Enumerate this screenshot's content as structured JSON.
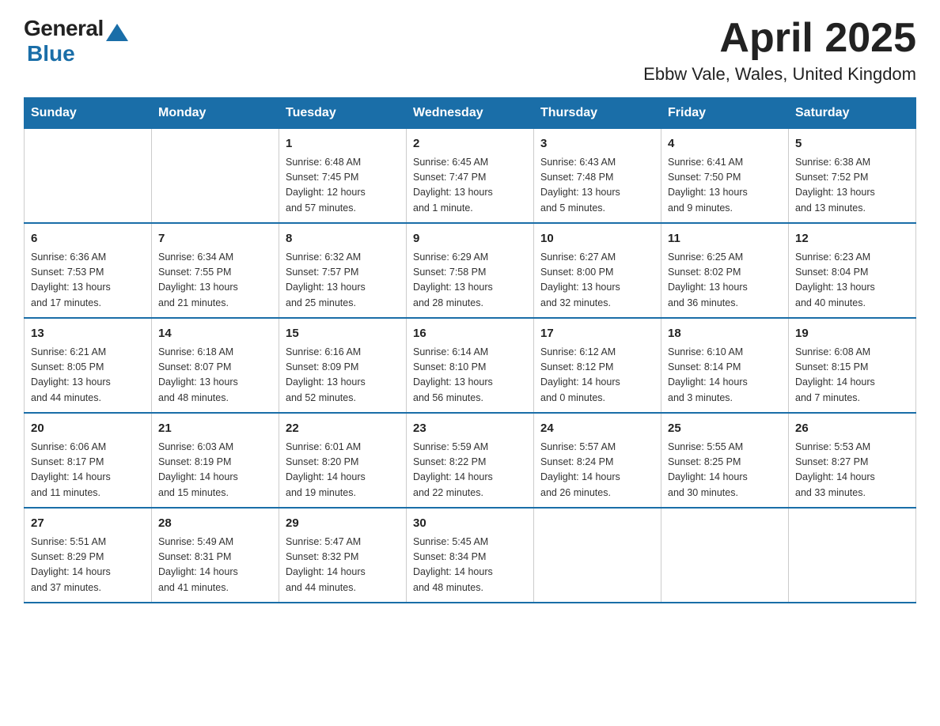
{
  "header": {
    "logo_general": "General",
    "logo_blue": "Blue",
    "title": "April 2025",
    "subtitle": "Ebbw Vale, Wales, United Kingdom"
  },
  "days_of_week": [
    "Sunday",
    "Monday",
    "Tuesday",
    "Wednesday",
    "Thursday",
    "Friday",
    "Saturday"
  ],
  "weeks": [
    [
      {
        "day": "",
        "info": ""
      },
      {
        "day": "",
        "info": ""
      },
      {
        "day": "1",
        "info": "Sunrise: 6:48 AM\nSunset: 7:45 PM\nDaylight: 12 hours\nand 57 minutes."
      },
      {
        "day": "2",
        "info": "Sunrise: 6:45 AM\nSunset: 7:47 PM\nDaylight: 13 hours\nand 1 minute."
      },
      {
        "day": "3",
        "info": "Sunrise: 6:43 AM\nSunset: 7:48 PM\nDaylight: 13 hours\nand 5 minutes."
      },
      {
        "day": "4",
        "info": "Sunrise: 6:41 AM\nSunset: 7:50 PM\nDaylight: 13 hours\nand 9 minutes."
      },
      {
        "day": "5",
        "info": "Sunrise: 6:38 AM\nSunset: 7:52 PM\nDaylight: 13 hours\nand 13 minutes."
      }
    ],
    [
      {
        "day": "6",
        "info": "Sunrise: 6:36 AM\nSunset: 7:53 PM\nDaylight: 13 hours\nand 17 minutes."
      },
      {
        "day": "7",
        "info": "Sunrise: 6:34 AM\nSunset: 7:55 PM\nDaylight: 13 hours\nand 21 minutes."
      },
      {
        "day": "8",
        "info": "Sunrise: 6:32 AM\nSunset: 7:57 PM\nDaylight: 13 hours\nand 25 minutes."
      },
      {
        "day": "9",
        "info": "Sunrise: 6:29 AM\nSunset: 7:58 PM\nDaylight: 13 hours\nand 28 minutes."
      },
      {
        "day": "10",
        "info": "Sunrise: 6:27 AM\nSunset: 8:00 PM\nDaylight: 13 hours\nand 32 minutes."
      },
      {
        "day": "11",
        "info": "Sunrise: 6:25 AM\nSunset: 8:02 PM\nDaylight: 13 hours\nand 36 minutes."
      },
      {
        "day": "12",
        "info": "Sunrise: 6:23 AM\nSunset: 8:04 PM\nDaylight: 13 hours\nand 40 minutes."
      }
    ],
    [
      {
        "day": "13",
        "info": "Sunrise: 6:21 AM\nSunset: 8:05 PM\nDaylight: 13 hours\nand 44 minutes."
      },
      {
        "day": "14",
        "info": "Sunrise: 6:18 AM\nSunset: 8:07 PM\nDaylight: 13 hours\nand 48 minutes."
      },
      {
        "day": "15",
        "info": "Sunrise: 6:16 AM\nSunset: 8:09 PM\nDaylight: 13 hours\nand 52 minutes."
      },
      {
        "day": "16",
        "info": "Sunrise: 6:14 AM\nSunset: 8:10 PM\nDaylight: 13 hours\nand 56 minutes."
      },
      {
        "day": "17",
        "info": "Sunrise: 6:12 AM\nSunset: 8:12 PM\nDaylight: 14 hours\nand 0 minutes."
      },
      {
        "day": "18",
        "info": "Sunrise: 6:10 AM\nSunset: 8:14 PM\nDaylight: 14 hours\nand 3 minutes."
      },
      {
        "day": "19",
        "info": "Sunrise: 6:08 AM\nSunset: 8:15 PM\nDaylight: 14 hours\nand 7 minutes."
      }
    ],
    [
      {
        "day": "20",
        "info": "Sunrise: 6:06 AM\nSunset: 8:17 PM\nDaylight: 14 hours\nand 11 minutes."
      },
      {
        "day": "21",
        "info": "Sunrise: 6:03 AM\nSunset: 8:19 PM\nDaylight: 14 hours\nand 15 minutes."
      },
      {
        "day": "22",
        "info": "Sunrise: 6:01 AM\nSunset: 8:20 PM\nDaylight: 14 hours\nand 19 minutes."
      },
      {
        "day": "23",
        "info": "Sunrise: 5:59 AM\nSunset: 8:22 PM\nDaylight: 14 hours\nand 22 minutes."
      },
      {
        "day": "24",
        "info": "Sunrise: 5:57 AM\nSunset: 8:24 PM\nDaylight: 14 hours\nand 26 minutes."
      },
      {
        "day": "25",
        "info": "Sunrise: 5:55 AM\nSunset: 8:25 PM\nDaylight: 14 hours\nand 30 minutes."
      },
      {
        "day": "26",
        "info": "Sunrise: 5:53 AM\nSunset: 8:27 PM\nDaylight: 14 hours\nand 33 minutes."
      }
    ],
    [
      {
        "day": "27",
        "info": "Sunrise: 5:51 AM\nSunset: 8:29 PM\nDaylight: 14 hours\nand 37 minutes."
      },
      {
        "day": "28",
        "info": "Sunrise: 5:49 AM\nSunset: 8:31 PM\nDaylight: 14 hours\nand 41 minutes."
      },
      {
        "day": "29",
        "info": "Sunrise: 5:47 AM\nSunset: 8:32 PM\nDaylight: 14 hours\nand 44 minutes."
      },
      {
        "day": "30",
        "info": "Sunrise: 5:45 AM\nSunset: 8:34 PM\nDaylight: 14 hours\nand 48 minutes."
      },
      {
        "day": "",
        "info": ""
      },
      {
        "day": "",
        "info": ""
      },
      {
        "day": "",
        "info": ""
      }
    ]
  ]
}
